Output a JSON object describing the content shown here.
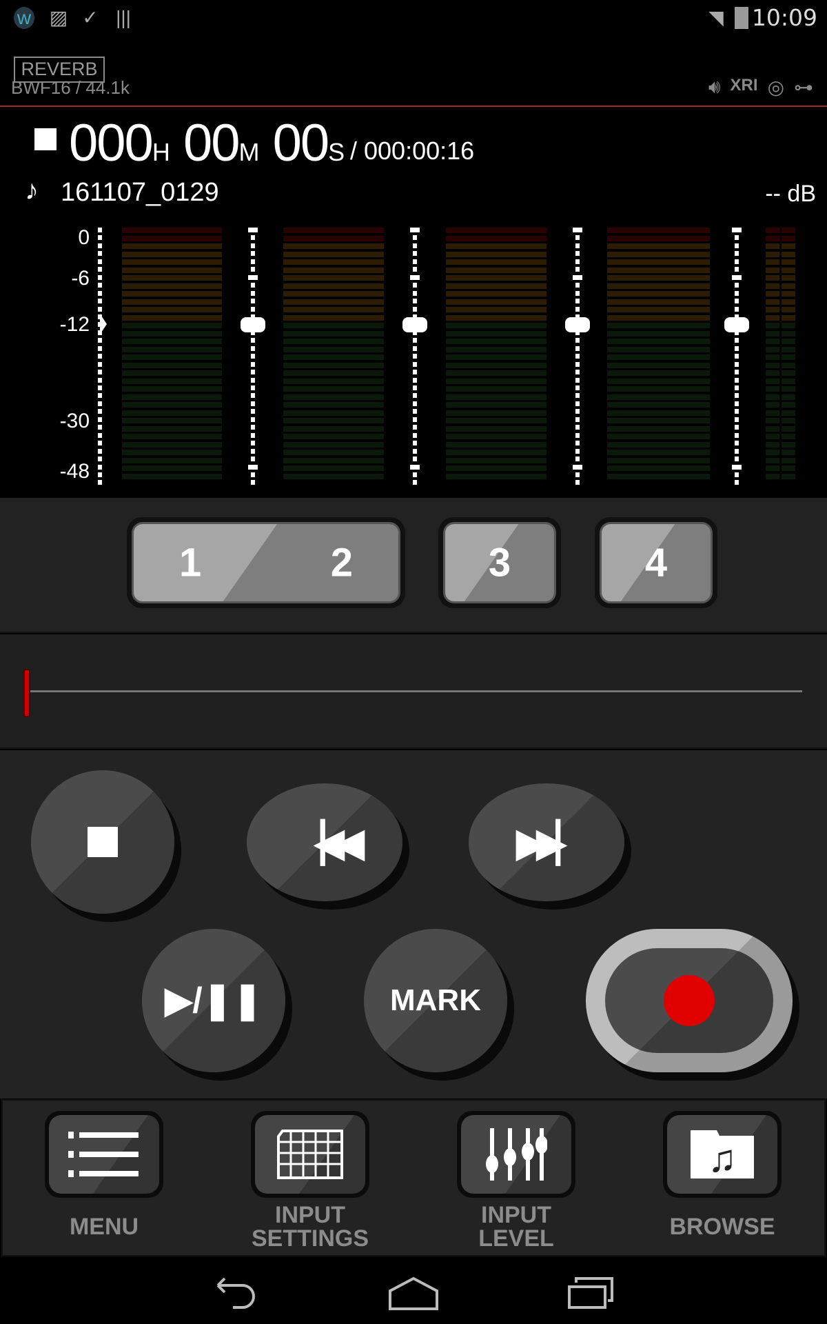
{
  "status_bar": {
    "time": "10:09",
    "left_icons": [
      "app-icon",
      "image-icon",
      "clipboard-check-icon",
      "barcode-icon"
    ],
    "right_icons": [
      "wifi-icon",
      "battery-charging-icon"
    ]
  },
  "header": {
    "effect_badge": "REVERB",
    "format": "BWF16 / 44.1k",
    "icons": [
      "speaker-icon",
      "xri-icon",
      "location-icon",
      "usb-icon"
    ]
  },
  "counter": {
    "hours": "000",
    "h_unit": "H",
    "minutes": "00",
    "m_unit": "M",
    "seconds": "00",
    "s_unit": "S",
    "total": "/ 000:00:16",
    "state": "stopped"
  },
  "file": {
    "name": "161107_0129",
    "level": "-- dB"
  },
  "meter": {
    "scale_labels": [
      "0",
      "-6",
      "-12",
      "-30",
      "-48"
    ],
    "channels": 5,
    "colors": {
      "over": "#2a0202",
      "high": "#2c1d02",
      "normal": "#0b190b"
    }
  },
  "channel_buttons": [
    {
      "labels": [
        "1",
        "2"
      ]
    },
    {
      "labels": [
        "3"
      ]
    },
    {
      "labels": [
        "4"
      ]
    }
  ],
  "transport": {
    "mark_label": "MARK",
    "record_color": "#e00000"
  },
  "bottom": [
    {
      "label": "MENU"
    },
    {
      "label": "INPUT\nSETTINGS"
    },
    {
      "label": "INPUT\nLEVEL"
    },
    {
      "label": "BROWSE"
    }
  ],
  "accent": "#a12828"
}
